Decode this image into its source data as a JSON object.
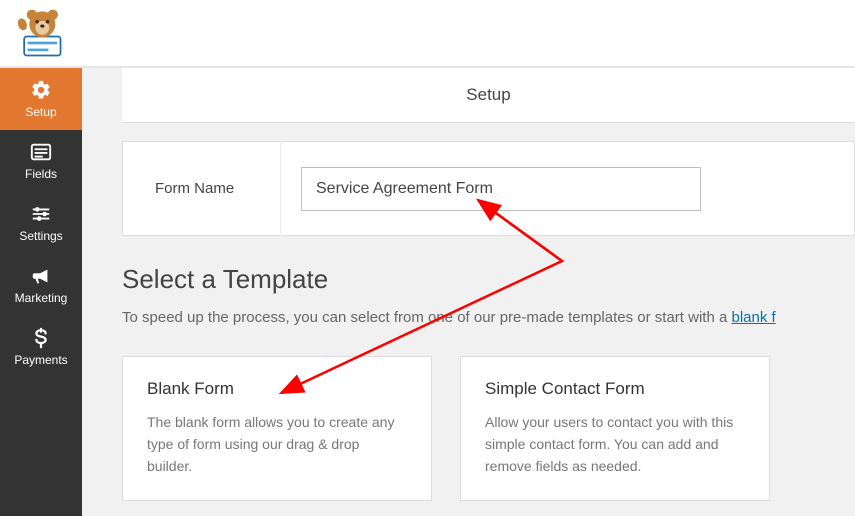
{
  "header": {
    "title": "Setup"
  },
  "sidebar": {
    "items": [
      {
        "label": "Setup",
        "icon": "gear"
      },
      {
        "label": "Fields",
        "icon": "list"
      },
      {
        "label": "Settings",
        "icon": "sliders"
      },
      {
        "label": "Marketing",
        "icon": "bullhorn"
      },
      {
        "label": "Payments",
        "icon": "dollar"
      }
    ]
  },
  "formName": {
    "label": "Form Name",
    "value": "Service Agreement Form"
  },
  "templates": {
    "heading": "Select a Template",
    "description_prefix": "To speed up the process, you can select from one of our pre-made templates or start with a ",
    "description_link": "blank f",
    "cards": [
      {
        "title": "Blank Form",
        "desc": "The blank form allows you to create any type of form using our drag & drop builder."
      },
      {
        "title": "Simple Contact Form",
        "desc": "Allow your users to contact you with this simple contact form. You can add and remove fields as needed."
      }
    ]
  }
}
